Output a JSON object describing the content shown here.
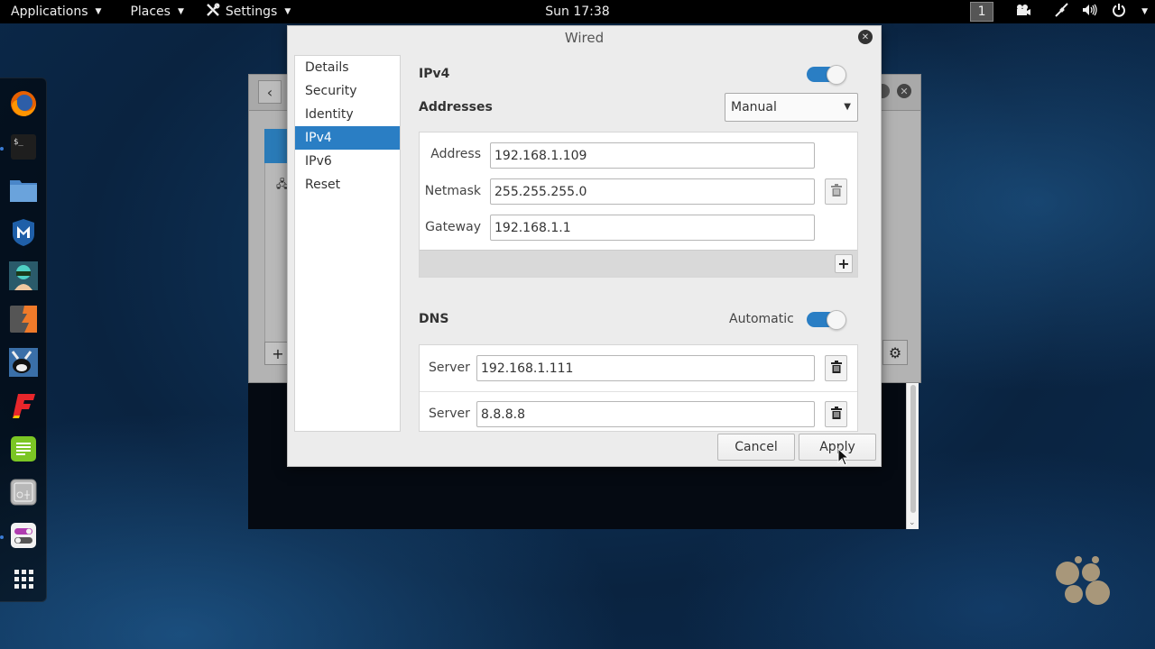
{
  "topbar": {
    "menus": [
      {
        "label": "Applications",
        "icon": "caret-down-icon"
      },
      {
        "label": "Places",
        "icon": "caret-down-icon"
      },
      {
        "label": "Settings",
        "icon": "tools-icon"
      }
    ],
    "clock": "Sun 17:38",
    "workspace": "1",
    "tray": [
      "camera-icon",
      "network-wired-icon",
      "volume-icon",
      "power-icon"
    ]
  },
  "dock": {
    "items": [
      {
        "name": "firefox",
        "icon": "firefox-icon",
        "running": false
      },
      {
        "name": "terminal",
        "icon": "terminal-icon",
        "running": true
      },
      {
        "name": "files",
        "icon": "folder-icon",
        "running": false
      },
      {
        "name": "metasploit",
        "icon": "metasploit-icon",
        "running": false
      },
      {
        "name": "armitage",
        "icon": "armitage-icon",
        "running": false
      },
      {
        "name": "burpsuite",
        "icon": "burpsuite-icon",
        "running": false
      },
      {
        "name": "beef",
        "icon": "beef-icon",
        "running": false
      },
      {
        "name": "faraday",
        "icon": "faraday-icon",
        "running": false
      },
      {
        "name": "leafpad",
        "icon": "text-editor-icon",
        "running": false
      },
      {
        "name": "cutycapt",
        "icon": "screenshot-icon",
        "running": false
      },
      {
        "name": "settings",
        "icon": "toggle-settings-icon",
        "running": true
      },
      {
        "name": "show-apps",
        "icon": "app-grid-icon",
        "running": false
      }
    ]
  },
  "dialog": {
    "title": "Wired",
    "nav": [
      "Details",
      "Security",
      "Identity",
      "IPv4",
      "IPv6",
      "Reset"
    ],
    "active_nav": "IPv4",
    "ipv4": {
      "title": "IPv4",
      "enabled": true,
      "addresses_label": "Addresses",
      "method": "Manual",
      "fields": [
        {
          "label": "Address",
          "value": "192.168.1.109"
        },
        {
          "label": "Netmask",
          "value": "255.255.255.0"
        },
        {
          "label": "Gateway",
          "value": "192.168.1.1"
        }
      ]
    },
    "dns": {
      "title": "DNS",
      "automatic_label": "Automatic",
      "automatic": true,
      "servers": [
        {
          "label": "Server",
          "value": "192.168.1.111"
        },
        {
          "label": "Server",
          "value": "8.8.8.8"
        }
      ]
    },
    "buttons": {
      "cancel": "Cancel",
      "apply": "Apply"
    }
  }
}
